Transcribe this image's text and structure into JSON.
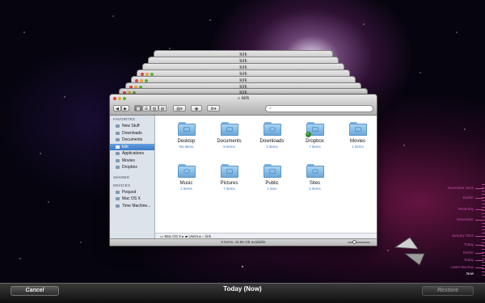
{
  "window": {
    "title": "kirk",
    "stack_titles": [
      "kirk",
      "kirk",
      "kirk",
      "kirk",
      "kirk",
      "kirk",
      "kirk"
    ],
    "search_placeholder": "",
    "view_buttons": [
      "▦",
      "☰",
      "▥",
      "▤"
    ],
    "status": "9 items, 43.85 GB available"
  },
  "sidebar": {
    "favorites_header": "FAVORITES",
    "favorites": [
      {
        "label": "New Stuff",
        "icon": "folder-icon"
      },
      {
        "label": "Downloads",
        "icon": "downloads-icon"
      },
      {
        "label": "Documents",
        "icon": "documents-icon"
      },
      {
        "label": "kirk",
        "icon": "home-icon",
        "selected": true
      },
      {
        "label": "Applications",
        "icon": "applications-icon"
      },
      {
        "label": "Movies",
        "icon": "movies-icon"
      },
      {
        "label": "Dropbox",
        "icon": "dropbox-icon"
      }
    ],
    "shared_header": "SHARED",
    "devices_header": "DEVICES",
    "devices": [
      {
        "label": "Pequod",
        "icon": "disk-icon"
      },
      {
        "label": "Mac OS X",
        "icon": "disk-icon"
      },
      {
        "label": "Time Machine...",
        "icon": "disk-icon"
      }
    ]
  },
  "folders": [
    {
      "name": "Desktop",
      "count": "No items",
      "icon": "desktop-folder-icon"
    },
    {
      "name": "Documents",
      "count": "9 items",
      "icon": "documents-folder-icon"
    },
    {
      "name": "Downloads",
      "count": "2 items",
      "icon": "downloads-folder-icon"
    },
    {
      "name": "Dropbox",
      "count": "7 items",
      "icon": "dropbox-folder-icon",
      "synced": true
    },
    {
      "name": "Movies",
      "count": "2 items",
      "icon": "movies-folder-icon"
    },
    {
      "name": "Music",
      "count": "2 items",
      "icon": "music-folder-icon"
    },
    {
      "name": "Pictures",
      "count": "7 items",
      "icon": "pictures-folder-icon"
    },
    {
      "name": "Public",
      "count": "1 item",
      "icon": "public-folder-icon"
    },
    {
      "name": "Sites",
      "count": "2 items",
      "icon": "sites-folder-icon"
    }
  ],
  "pathbar": {
    "segments": [
      "Mac OS X",
      "Users",
      "kirk"
    ],
    "separator": "▸"
  },
  "timeline": {
    "labels": [
      "November 2012",
      "Earlier",
      "Yesterday",
      "December",
      "January 2012",
      "Today",
      "Earlier",
      "Today",
      "Latest Backup",
      "Now"
    ]
  },
  "bottom": {
    "cancel_label": "Cancel",
    "today_label": "Today (Now)",
    "restore_label": "Restore"
  },
  "colors": {
    "accent": "#3d7ac7",
    "timeline": "#c24da9",
    "folder": "#6aa8da"
  }
}
